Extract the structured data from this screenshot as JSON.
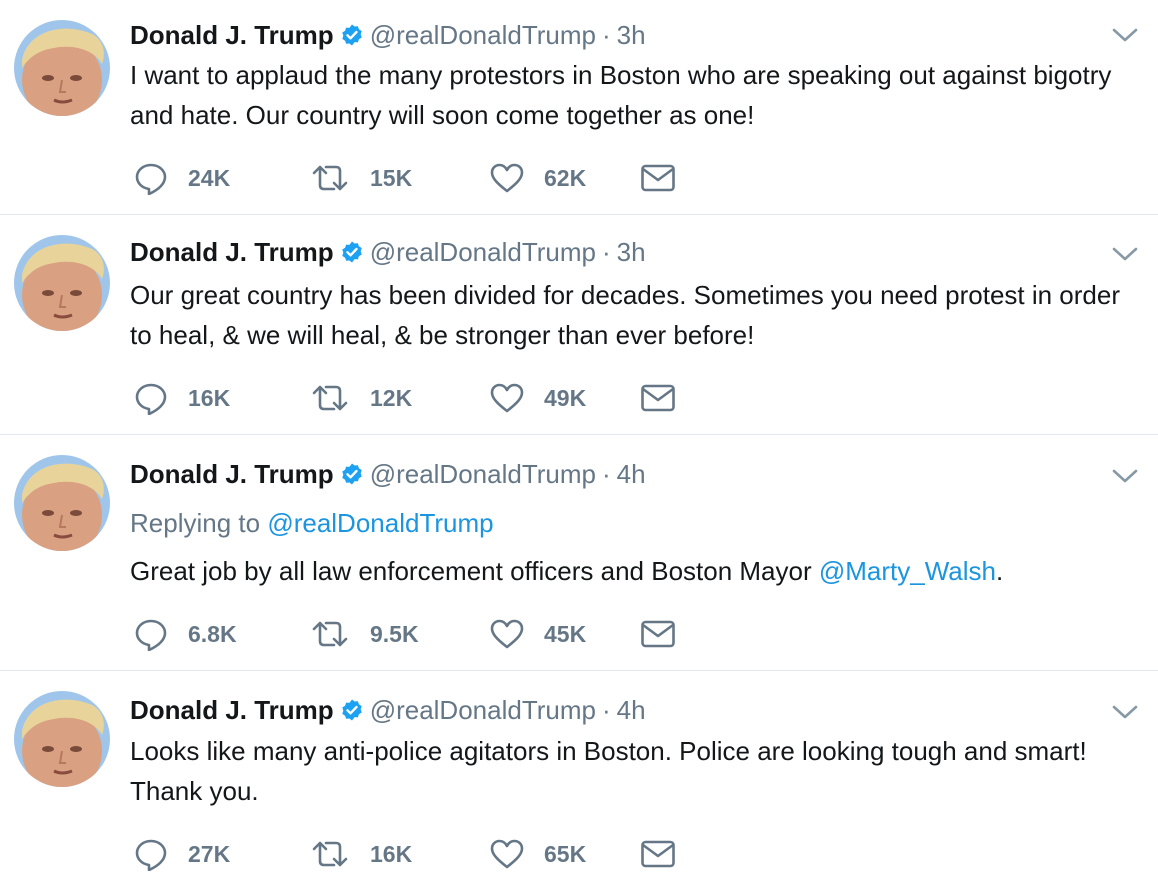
{
  "colors": {
    "link": "#1b95e0",
    "secondary": "#657786",
    "verified": "#1da1f2",
    "divider": "#e1e8ed"
  },
  "tweets": [
    {
      "name": "Donald J. Trump",
      "handle": "@realDonaldTrump",
      "separator": "·",
      "time": "3h",
      "text": "I want to applaud the many protestors in Boston who are speaking out against bigotry and hate. Our country will soon come together as one!",
      "counts": {
        "replies": "24K",
        "retweets": "15K",
        "likes": "62K"
      }
    },
    {
      "name": "Donald J. Trump",
      "handle": "@realDonaldTrump",
      "separator": "·",
      "time": "3h",
      "text": "Our great country has been divided for decades. Sometimes you need protest in order to heal, & we will heal, & be stronger than ever before!",
      "counts": {
        "replies": "16K",
        "retweets": "12K",
        "likes": "49K"
      }
    },
    {
      "name": "Donald J. Trump",
      "handle": "@realDonaldTrump",
      "separator": "·",
      "time": "4h",
      "replying_prefix": "Replying to",
      "replying_handle": "@realDonaldTrump",
      "text_before": "Great job by all law enforcement officers and Boston Mayor",
      "mention": "@Marty_Walsh",
      "text_after": ".",
      "counts": {
        "replies": "6.8K",
        "retweets": "9.5K",
        "likes": "45K"
      }
    },
    {
      "name": "Donald J. Trump",
      "handle": "@realDonaldTrump",
      "separator": "·",
      "time": "4h",
      "text": "Looks like many anti-police agitators in Boston. Police are looking tough and smart! Thank you.",
      "counts": {
        "replies": "27K",
        "retweets": "16K",
        "likes": "65K"
      }
    }
  ],
  "icons": {
    "verified": "verified-badge-icon",
    "caret": "chevron-down-icon",
    "reply": "reply-icon",
    "retweet": "retweet-icon",
    "like": "heart-icon",
    "dm": "envelope-icon"
  }
}
